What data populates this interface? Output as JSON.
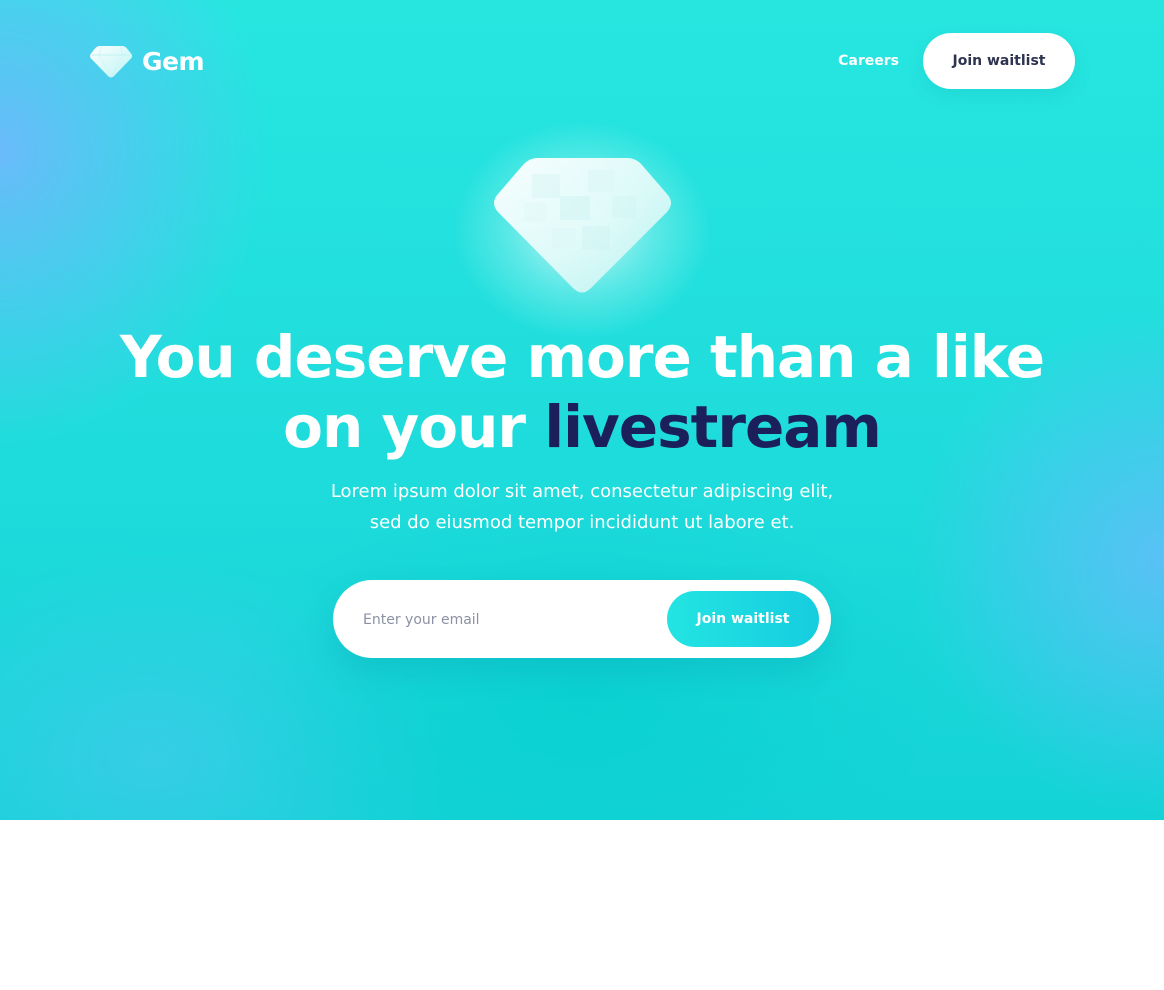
{
  "brand": {
    "name": "Gem",
    "logo_icon": "gem-icon"
  },
  "nav": {
    "careers_label": "Careers",
    "join_label": "Join waitlist"
  },
  "hero": {
    "icon": "gem-icon",
    "headline_part1": "You deserve more than a like on your ",
    "headline_accent": "livestream",
    "subtext_line1": "Lorem ipsum dolor sit amet, consectetur adipiscing elit,",
    "subtext_line2": "sed do eiusmod tempor incididunt ut labore et."
  },
  "form": {
    "email_placeholder": "Enter your email",
    "email_value": "",
    "submit_label": "Join waitlist"
  },
  "colors": {
    "hero_gradient_start": "#27e6e0",
    "hero_gradient_edge": "#6eb8ff",
    "accent_text": "#1b1f5a",
    "button_text_dark": "#2e3450"
  }
}
